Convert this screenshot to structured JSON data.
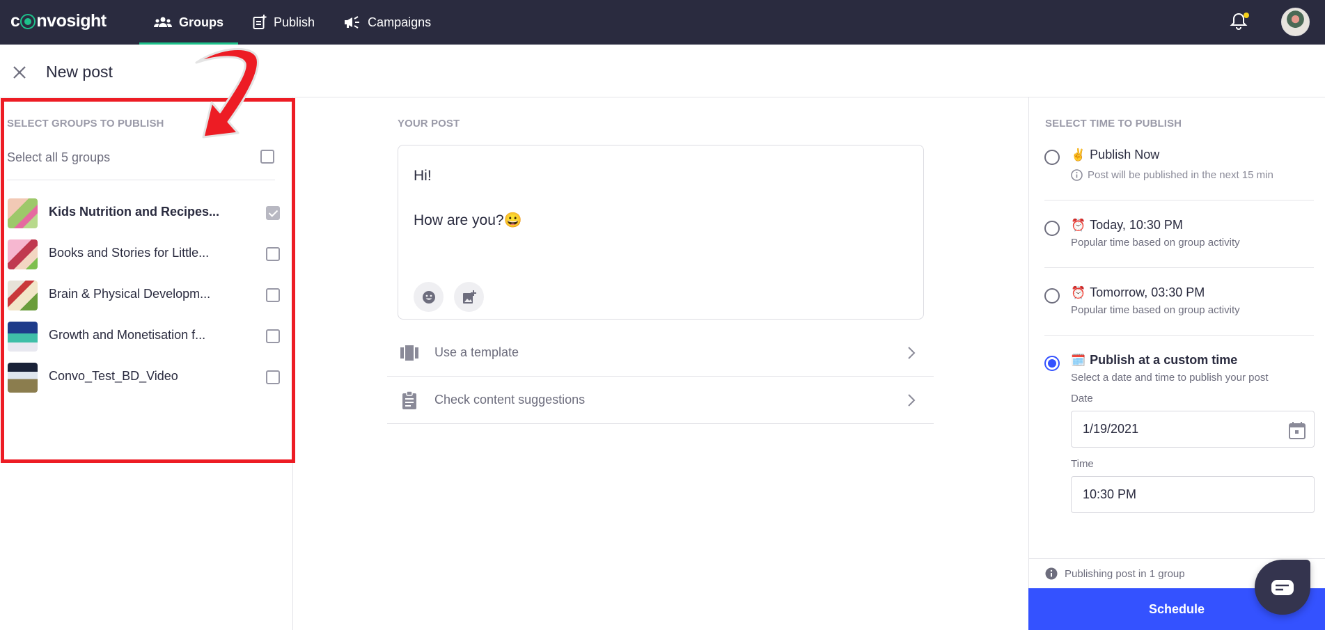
{
  "app": {
    "brand": "convosight",
    "nav": [
      {
        "label": "Groups",
        "icon": "groups-icon",
        "active": true
      },
      {
        "label": "Publish",
        "icon": "publish-icon",
        "active": false
      },
      {
        "label": "Campaigns",
        "icon": "megaphone-icon",
        "active": false
      }
    ],
    "notification_dot_color": "#f5d01a",
    "accent_color": "#1ec28b"
  },
  "page": {
    "title": "New post"
  },
  "groups_panel": {
    "label": "SELECT GROUPS TO PUBLISH",
    "select_all_label": "Select all 5 groups",
    "select_all_checked": false,
    "groups": [
      {
        "name": "Kids Nutrition and Recipes...",
        "checked": true
      },
      {
        "name": "Books and Stories for Little...",
        "checked": false
      },
      {
        "name": "Brain & Physical Developm...",
        "checked": false
      },
      {
        "name": "Growth and Monetisation f...",
        "checked": false
      },
      {
        "name": "Convo_Test_BD_Video",
        "checked": false
      }
    ]
  },
  "post_panel": {
    "label": "YOUR POST",
    "content_lines": [
      "Hi!",
      "How are you?😀"
    ],
    "tools": [
      "emoji-icon",
      "add-image-icon"
    ],
    "options": [
      {
        "label": "Use a template",
        "icon": "template-icon"
      },
      {
        "label": "Check content suggestions",
        "icon": "clipboard-icon"
      }
    ]
  },
  "time_panel": {
    "label": "SELECT TIME TO PUBLISH",
    "options": [
      {
        "emoji": "✌️",
        "title": "Publish Now",
        "subtitle": "Post will be published in the next 15 min",
        "selected": false
      },
      {
        "emoji": "⏰",
        "title": "Today, 10:30 PM",
        "subtitle": "Popular time based on group activity",
        "selected": false
      },
      {
        "emoji": "⏰",
        "title": "Tomorrow, 03:30 PM",
        "subtitle": "Popular time based on group activity",
        "selected": false
      },
      {
        "emoji": "🗓️",
        "title": "Publish at a custom time",
        "subtitle": "Select a date and time to publish your post",
        "selected": true
      }
    ],
    "date_label": "Date",
    "date_value": "1/19/2021",
    "time_label": "Time",
    "time_value": "10:30 PM",
    "footer_info": "Publishing post in 1 group",
    "schedule_label": "Schedule",
    "primary_color": "#3452ff"
  },
  "annotation": {
    "highlight_color": "#ed1c24"
  }
}
